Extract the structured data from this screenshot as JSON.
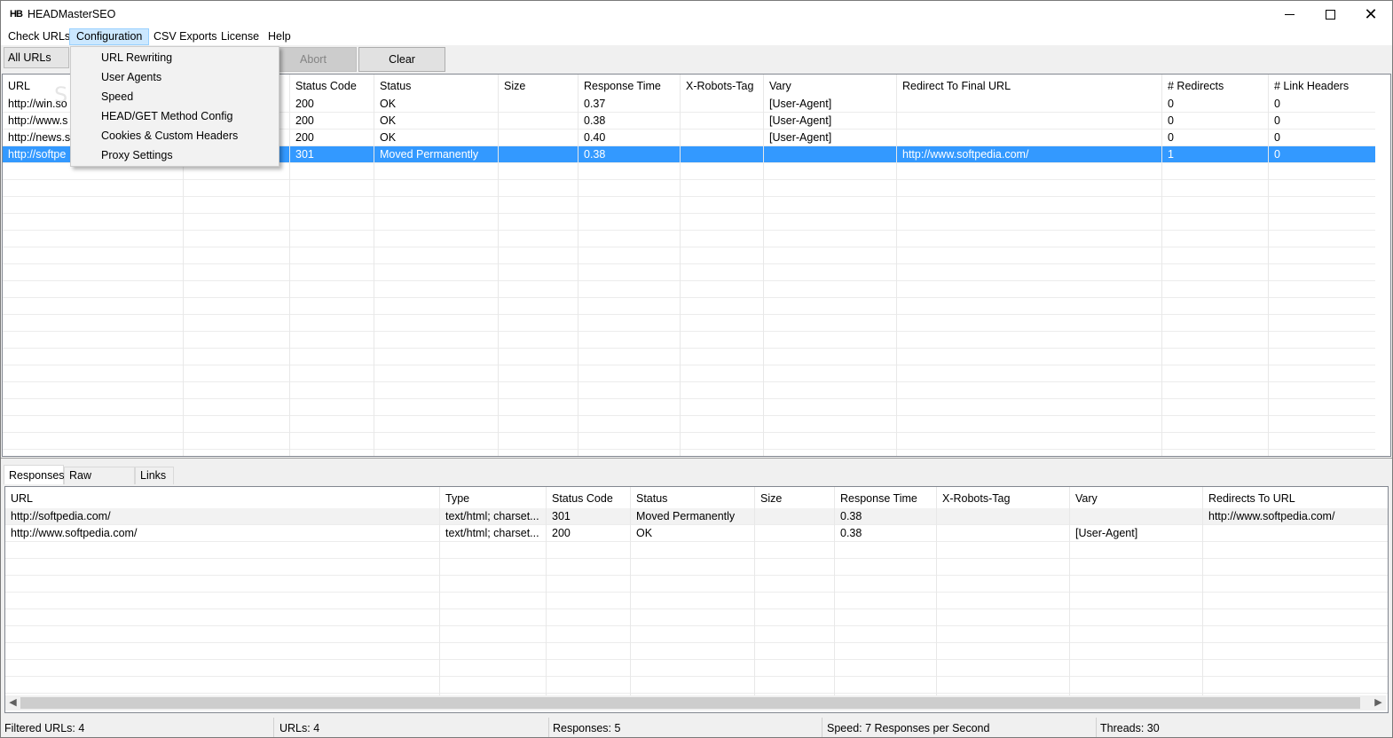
{
  "window": {
    "title": "HEADMasterSEO",
    "icon_text": "HB"
  },
  "menubar": {
    "items": [
      "Check URLs",
      "Configuration",
      "CSV Exports",
      "License",
      "Help"
    ]
  },
  "config_menu": {
    "items": [
      "URL Rewriting",
      "User Agents",
      "Speed",
      "HEAD/GET Method Config",
      "Cookies & Custom Headers",
      "Proxy Settings"
    ]
  },
  "toolbar": {
    "filter_value": "All URLs",
    "abort_label": "Abort",
    "clear_label": "Clear"
  },
  "watermark": "SOFTPEDIA",
  "main_table": {
    "headers": [
      "URL",
      "",
      "Status Code",
      "Status",
      "Size",
      "Response Time",
      "X-Robots-Tag",
      "Vary",
      "Redirect To Final URL",
      "# Redirects",
      "# Link Headers"
    ],
    "rows": [
      [
        "http://win.so",
        "",
        "200",
        "OK",
        "",
        "0.37",
        "",
        "[User-Agent]",
        "",
        "0",
        "0"
      ],
      [
        "http://www.s",
        "",
        "200",
        "OK",
        "",
        "0.38",
        "",
        "[User-Agent]",
        "",
        "0",
        "0"
      ],
      [
        "http://news.s",
        "",
        "200",
        "OK",
        "",
        "0.40",
        "",
        "[User-Agent]",
        "",
        "0",
        "0"
      ],
      [
        "http://softpe",
        "",
        "301",
        "Moved Permanently",
        "",
        "0.38",
        "",
        "",
        "http://www.softpedia.com/",
        "1",
        "0"
      ]
    ],
    "selected_row": 3
  },
  "tabs": [
    "Responses",
    "Raw Headers",
    "Links"
  ],
  "responses_table": {
    "headers": [
      "URL",
      "Type",
      "Status Code",
      "Status",
      "Size",
      "Response Time",
      "X-Robots-Tag",
      "Vary",
      "Redirects To URL"
    ],
    "rows": [
      [
        "http://softpedia.com/",
        "text/html; charset...",
        "301",
        "Moved Permanently",
        "",
        "0.38",
        "",
        "",
        "http://www.softpedia.com/"
      ],
      [
        "http://www.softpedia.com/",
        "text/html; charset...",
        "200",
        "OK",
        "",
        "0.38",
        "",
        "[User-Agent]",
        ""
      ]
    ]
  },
  "statusbar": {
    "filtered": "Filtered URLs: 4",
    "urls": "URLs: 4",
    "responses": "Responses: 5",
    "speed": "Speed: 7 Responses per Second",
    "threads": "Threads: 30"
  },
  "colors": {
    "selection": "#3399ff",
    "menu_highlight": "#cce8ff"
  },
  "icons": [
    "app-icon",
    "minimize-icon",
    "maximize-icon",
    "close-icon",
    "scroll-left-icon",
    "scroll-right-icon"
  ]
}
